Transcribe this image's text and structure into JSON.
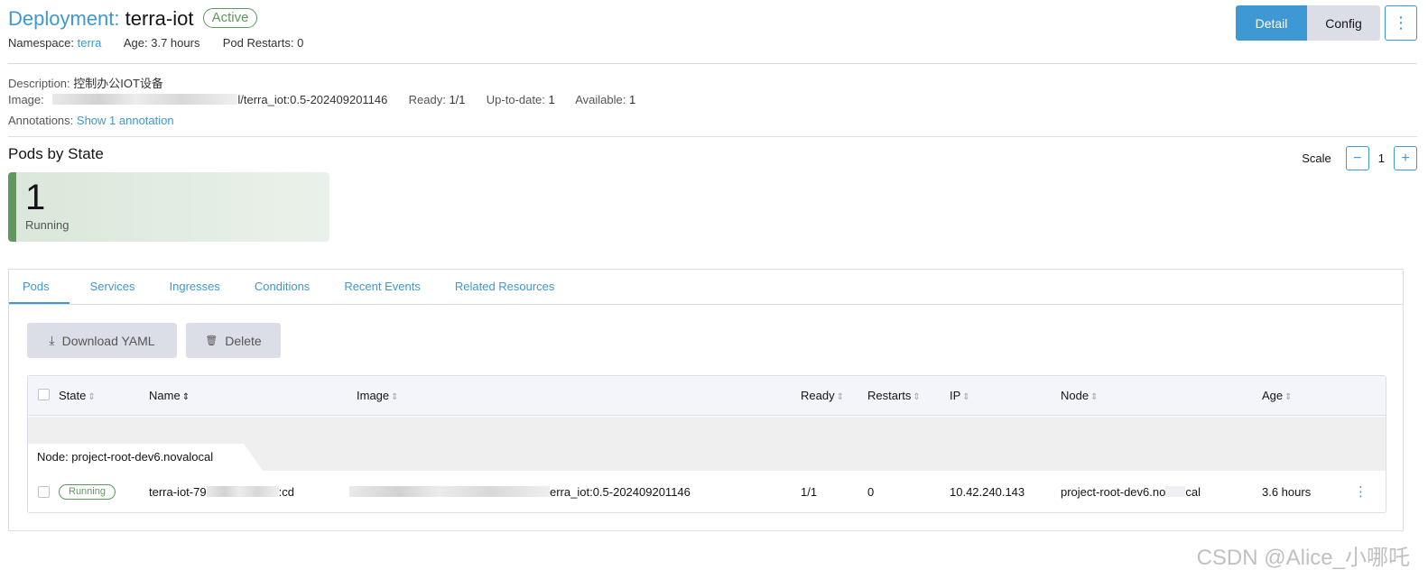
{
  "header": {
    "kind": "Deployment:",
    "name": "terra-iot",
    "status": "Active",
    "namespace_label": "Namespace:",
    "namespace": "terra",
    "age_label": "Age:",
    "age": "3.7 hours",
    "restarts_label": "Pod Restarts:",
    "restarts": "0",
    "detail_btn": "Detail",
    "config_btn": "Config"
  },
  "meta": {
    "description_label": "Description:",
    "description": "控制办公IOT设备",
    "image_label": "Image:",
    "image_visible": "l/terra_iot:0.5-202409201146",
    "ready_label": "Ready:",
    "ready": "1/1",
    "uptodate_label": "Up-to-date:",
    "uptodate": "1",
    "available_label": "Available:",
    "available": "1",
    "annotations_label": "Annotations:",
    "annotations_link": "Show 1 annotation"
  },
  "pods_by_state": {
    "title": "Pods by State",
    "scale_label": "Scale",
    "scale_value": "1",
    "count": "1",
    "state": "Running",
    "state_color": "#5d995d"
  },
  "tabs": [
    "Pods",
    "Services",
    "Ingresses",
    "Conditions",
    "Recent Events",
    "Related Resources"
  ],
  "actions": {
    "download": "Download YAML",
    "delete": "Delete"
  },
  "table": {
    "columns": [
      "State",
      "Name",
      "Image",
      "Ready",
      "Restarts",
      "IP",
      "Node",
      "Age"
    ],
    "group_label": "Node: project-root-dev6.novalocal",
    "row": {
      "state": "Running",
      "name_prefix": "terra-iot-79",
      "name_suffix": ":cd",
      "image_visible": "erra_iot:0.5-202409201146",
      "ready": "1/1",
      "restarts": "0",
      "ip": "10.42.240.143",
      "node_prefix": "project-root-dev6.no",
      "node_suffix": "cal",
      "age": "3.6 hours"
    }
  },
  "watermark": "CSDN @Alice_小哪吒",
  "colors": {
    "accent": "#3d98d3",
    "success": "#5d995d",
    "border": "#dcdee7"
  }
}
